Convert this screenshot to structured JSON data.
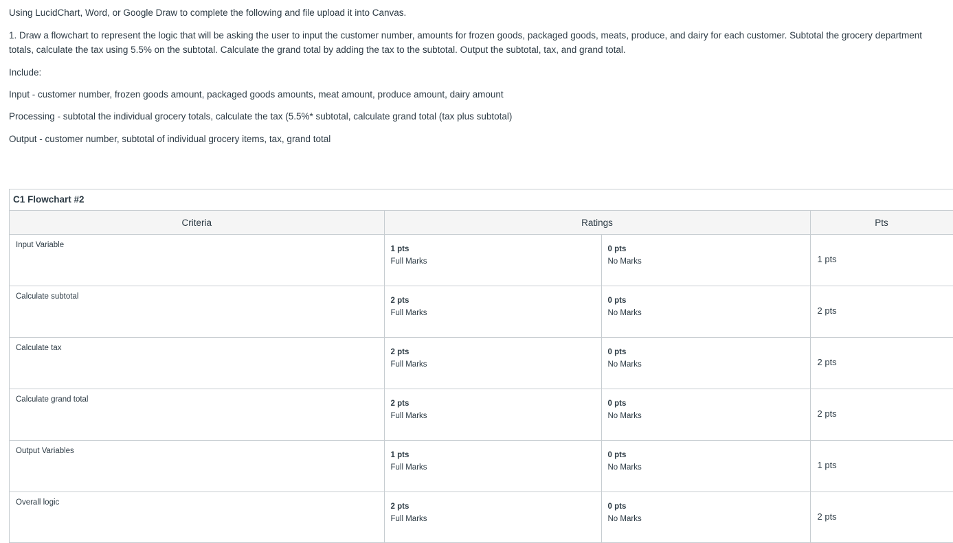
{
  "instructions": {
    "intro": "Using LucidChart, Word, or Google Draw to complete the following and file upload it into Canvas.",
    "task": "1. Draw a flowchart to represent the logic that will be asking the user to input the customer number, amounts for frozen goods, packaged goods, meats, produce, and dairy for each customer. Subtotal the grocery department totals, calculate the tax using 5.5% on the subtotal. Calculate the grand total by adding the tax to the subtotal. Output the subtotal, tax, and grand total.",
    "include_label": "Include:",
    "input_line": "Input - customer number, frozen goods amount, packaged goods amounts, meat amount, produce amount, dairy amount",
    "processing_line": "Processing - subtotal the individual grocery totals, calculate the tax (5.5%* subtotal, calculate grand total (tax plus subtotal)",
    "output_line": "Output - customer number, subtotal of individual grocery items, tax, grand total"
  },
  "rubric": {
    "title": "C1 Flowchart #2",
    "headers": {
      "criteria": "Criteria",
      "ratings": "Ratings",
      "pts": "Pts"
    },
    "rows": [
      {
        "criterion": "Input Variable",
        "full_pts": "1 pts",
        "full_label": "Full Marks",
        "no_pts": "0 pts",
        "no_label": "No Marks",
        "total": "1 pts"
      },
      {
        "criterion": "Calculate subtotal",
        "full_pts": "2 pts",
        "full_label": "Full Marks",
        "no_pts": "0 pts",
        "no_label": "No Marks",
        "total": "2 pts"
      },
      {
        "criterion": "Calculate tax",
        "full_pts": "2 pts",
        "full_label": "Full Marks",
        "no_pts": "0 pts",
        "no_label": "No Marks",
        "total": "2 pts"
      },
      {
        "criterion": "Calculate grand total",
        "full_pts": "2 pts",
        "full_label": "Full Marks",
        "no_pts": "0 pts",
        "no_label": "No Marks",
        "total": "2 pts"
      },
      {
        "criterion": "Output Variables",
        "full_pts": "1 pts",
        "full_label": "Full Marks",
        "no_pts": "0 pts",
        "no_label": "No Marks",
        "total": "1 pts"
      },
      {
        "criterion": "Overall logic",
        "full_pts": "2 pts",
        "full_label": "Full Marks",
        "no_pts": "0 pts",
        "no_label": "No Marks",
        "total": "2 pts"
      }
    ]
  },
  "colors": {
    "text": "#2d3b45",
    "border": "#c7cdd1",
    "header_bg": "#f5f5f5"
  }
}
